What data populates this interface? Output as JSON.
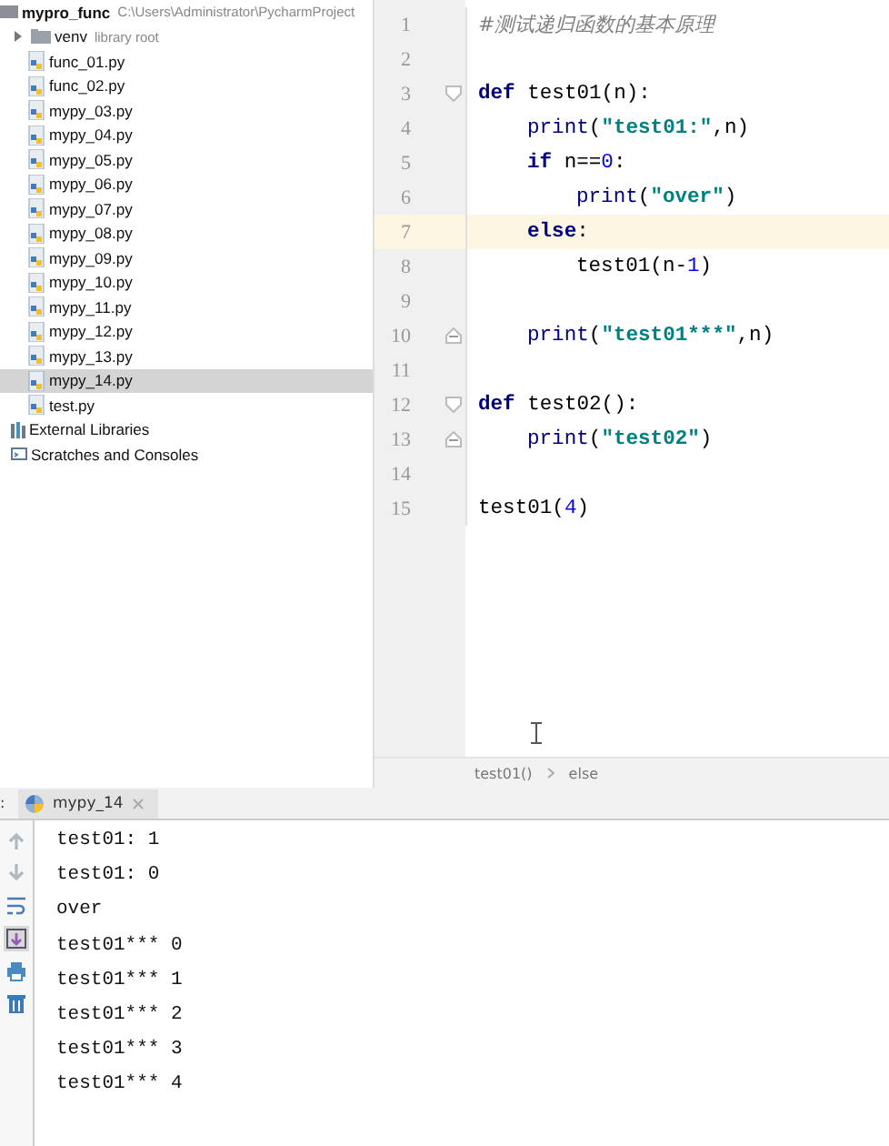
{
  "project_tree": [
    {
      "label": "mypro_func",
      "detail": "C:\\Users\\Administrator\\PycharmProject",
      "kind": "project",
      "selected": false,
      "children": [
        {
          "label": "venv",
          "detail": "library root",
          "kind": "folder",
          "expanded": false,
          "selected": false
        },
        {
          "label": "func_01.py",
          "kind": "file",
          "selected": false
        },
        {
          "label": "func_02.py",
          "kind": "file",
          "selected": false
        },
        {
          "label": "mypy_03.py",
          "kind": "file",
          "selected": false
        },
        {
          "label": "mypy_04.py",
          "kind": "file",
          "selected": false
        },
        {
          "label": "mypy_05.py",
          "kind": "file",
          "selected": false
        },
        {
          "label": "mypy_06.py",
          "kind": "file",
          "selected": false
        },
        {
          "label": "mypy_07.py",
          "kind": "file",
          "selected": false
        },
        {
          "label": "mypy_08.py",
          "kind": "file",
          "selected": false
        },
        {
          "label": "mypy_09.py",
          "kind": "file",
          "selected": false
        },
        {
          "label": "mypy_10.py",
          "kind": "file",
          "selected": false
        },
        {
          "label": "mypy_11.py",
          "kind": "file",
          "selected": false
        },
        {
          "label": "mypy_12.py",
          "kind": "file",
          "selected": false
        },
        {
          "label": "mypy_13.py",
          "kind": "file",
          "selected": false
        },
        {
          "label": "mypy_14.py",
          "kind": "file",
          "selected": true
        },
        {
          "label": "test.py",
          "kind": "file",
          "selected": false
        }
      ]
    },
    {
      "label": "External Libraries",
      "kind": "libraries",
      "selected": false
    },
    {
      "label": "Scratches and Consoles",
      "kind": "scratches",
      "selected": false
    }
  ],
  "editor": {
    "lines": [
      {
        "number": "1",
        "current": false,
        "tokens": [
          {
            "kind": "comment",
            "text": "#测试递归函数的基本原理"
          }
        ]
      },
      {
        "number": "2",
        "current": false
      },
      {
        "number": "3",
        "current": false,
        "fold_open": true,
        "tokens": [
          {
            "kind": "keyword",
            "text": "def"
          },
          {
            "kind": "plain",
            "text": "test01(n):"
          }
        ],
        "children": [
          {
            "number": "4",
            "current": false,
            "tokens": [
              {
                "kind": "builtin",
                "text": "print"
              },
              {
                "kind": "plain",
                "text": "("
              },
              {
                "kind": "string",
                "text": "\"test01:\""
              },
              {
                "kind": "plain",
                "text": ",n)"
              }
            ]
          },
          {
            "number": "5",
            "current": false,
            "tokens": [
              {
                "kind": "keyword",
                "text": "if"
              },
              {
                "kind": "plain",
                "text": "n=="
              },
              {
                "kind": "number",
                "text": "0"
              },
              {
                "kind": "plain",
                "text": ":"
              }
            ],
            "children": [
              {
                "number": "6",
                "current": false,
                "tokens": [
                  {
                    "kind": "builtin",
                    "text": "print"
                  },
                  {
                    "kind": "plain",
                    "text": "("
                  },
                  {
                    "kind": "string",
                    "text": "\"over\""
                  },
                  {
                    "kind": "plain",
                    "text": ")"
                  }
                ]
              }
            ]
          },
          {
            "number": "7",
            "current": true,
            "tokens": [
              {
                "kind": "keyword",
                "text": "else"
              },
              {
                "kind": "plain",
                "text": ":"
              }
            ],
            "children": [
              {
                "number": "8",
                "current": false,
                "tokens": [
                  {
                    "kind": "plain",
                    "text": "test01(n-"
                  },
                  {
                    "kind": "number",
                    "text": "1"
                  },
                  {
                    "kind": "plain",
                    "text": ")"
                  }
                ]
              }
            ]
          },
          {
            "number": "9",
            "current": false
          },
          {
            "number": "10",
            "current": false,
            "fold_close": true,
            "tokens": [
              {
                "kind": "builtin",
                "text": "print"
              },
              {
                "kind": "plain",
                "text": "("
              },
              {
                "kind": "string",
                "text": "\"test01***\""
              },
              {
                "kind": "plain",
                "text": ",n)"
              }
            ]
          }
        ]
      },
      {
        "number": "11",
        "current": false
      },
      {
        "number": "12",
        "current": false,
        "fold_open": true,
        "tokens": [
          {
            "kind": "keyword",
            "text": "def"
          },
          {
            "kind": "plain",
            "text": "test02():"
          }
        ],
        "children": [
          {
            "number": "13",
            "current": false,
            "fold_close": true,
            "tokens": [
              {
                "kind": "builtin",
                "text": "print"
              },
              {
                "kind": "plain",
                "text": "("
              },
              {
                "kind": "string",
                "text": "\"test02\""
              },
              {
                "kind": "plain",
                "text": ")"
              }
            ]
          }
        ]
      },
      {
        "number": "14",
        "current": false
      },
      {
        "number": "15",
        "current": false,
        "tokens": [
          {
            "kind": "plain",
            "text": "test01("
          },
          {
            "kind": "number",
            "text": "4"
          },
          {
            "kind": "plain",
            "text": ")"
          }
        ]
      }
    ],
    "breadcrumbs": [
      "test01()",
      "else"
    ]
  },
  "run_panel": {
    "label": ":",
    "tabs": [
      {
        "label": "mypy_14",
        "selected": true
      }
    ],
    "toolbar": [
      {
        "kind": "up",
        "selected": false
      },
      {
        "kind": "down",
        "selected": false
      },
      {
        "kind": "wrap",
        "selected": false
      },
      {
        "kind": "scroll",
        "selected": true
      },
      {
        "kind": "print",
        "selected": false
      },
      {
        "kind": "trash",
        "selected": false
      }
    ],
    "output": [
      "test01: 1",
      "test01: 0",
      "over",
      "test01*** 0",
      "test01*** 1",
      "test01*** 2",
      "test01*** 3",
      "test01*** 4"
    ]
  }
}
